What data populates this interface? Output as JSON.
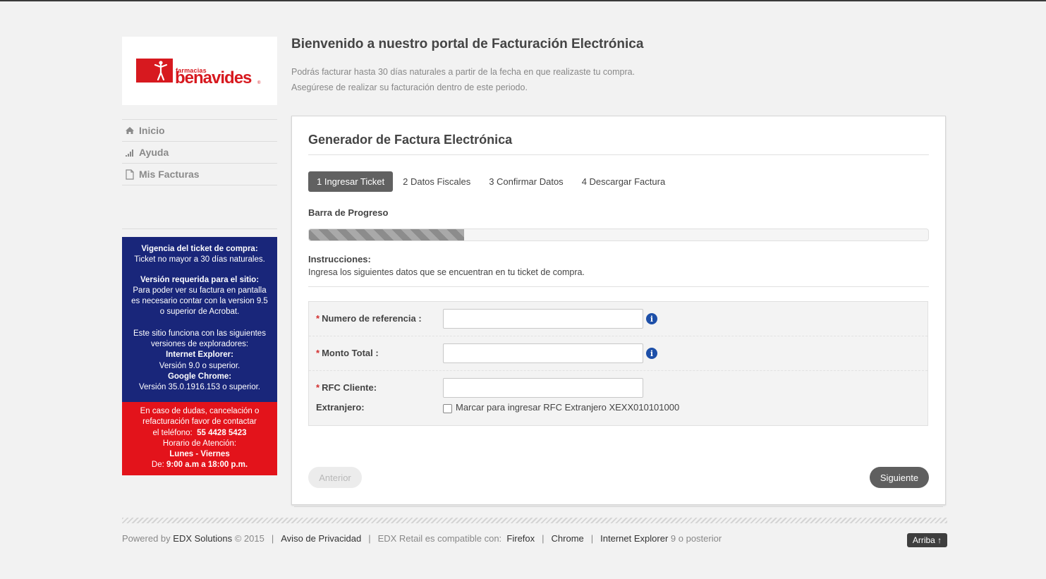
{
  "brand": {
    "logo_small": "farmacias",
    "logo_big": "benavides",
    "logo_reg": "®",
    "color": "#d7191f"
  },
  "header": {
    "title": "Bienvenido a nuestro portal de Facturación Electrónica",
    "line1": "Podrás facturar hasta 30 días naturales a partir de la fecha en que realizaste tu compra.",
    "line2": "Asegúrese de realizar su facturación dentro de este periodo."
  },
  "nav": {
    "items": [
      {
        "label": "Inicio",
        "icon": "home-icon"
      },
      {
        "label": "Ayuda",
        "icon": "signal-bars-icon"
      },
      {
        "label": "Mis Facturas",
        "icon": "document-icon"
      }
    ]
  },
  "info_blue": {
    "vigencia_title": "Vigencia del ticket de compra:",
    "vigencia_text": "Ticket no mayor a 30 días naturales.",
    "version_title": "Versión requerida para el sitio:",
    "version_l1": "Para poder ver su factura en pantalla",
    "version_l2": "es necesario contar con la version 9.5",
    "version_l3": "o superior de Acrobat.",
    "browsers_l1": "Este sitio funciona con las siguientes",
    "browsers_l2": "versiones de exploradores:",
    "ie_title": "Internet Explorer:",
    "ie_version": "Versión 9.0 o superior.",
    "chrome_title": "Google Chrome:",
    "chrome_version": "Versión 35.0.1916.153 o superior.",
    "color": "#19267a"
  },
  "info_red": {
    "l1": "En caso de dudas, cancelación o",
    "l2": "refacturación favor de contactar",
    "l3": "el teléfono:",
    "phone": "55 4428 5423",
    "l4": "Horario de Atención:",
    "days": "Lunes - Viernes",
    "hours_prefix": "De:",
    "hours": "9:00 a.m a 18:00 p.m.",
    "color": "#e3131b"
  },
  "card": {
    "title": "Generador de Factura Electrónica",
    "steps": [
      {
        "label": "1 Ingresar Ticket",
        "active": true
      },
      {
        "label": "2 Datos Fiscales",
        "active": false
      },
      {
        "label": "3 Confirmar Datos",
        "active": false
      },
      {
        "label": "4 Descargar Factura",
        "active": false
      }
    ],
    "progress_label": "Barra de Progreso",
    "progress_fraction": 0.25,
    "instructions_title": "Instrucciones:",
    "instructions_text": "Ingresa los siguientes datos que se encuentran en tu ticket de compra."
  },
  "form": {
    "required_mark": "*",
    "referencia_label": "Numero de referencia :",
    "referencia_value": "",
    "monto_label": "Monto Total :",
    "monto_value": "",
    "rfc_label": "RFC Cliente:",
    "rfc_value": "",
    "extranjero_label": "Extranjero:",
    "extranjero_checkbox_label": "Marcar para ingresar RFC Extranjero XEXX010101000",
    "extranjero_checked": false,
    "info_icon_glyph": "i"
  },
  "buttons": {
    "prev": "Anterior",
    "next": "Siguiente"
  },
  "footer": {
    "powered_prefix": "Powered by",
    "powered_company": "EDX Solutions",
    "powered_year": "© 2015",
    "separator": "|",
    "privacy": "Aviso de Privacidad",
    "compat_text": "EDX Retail es compatible con:",
    "firefox": "Firefox",
    "chrome": "Chrome",
    "ie": "Internet Explorer",
    "ie_suffix": "9 o posterior",
    "top_button": "Arriba ↑"
  }
}
